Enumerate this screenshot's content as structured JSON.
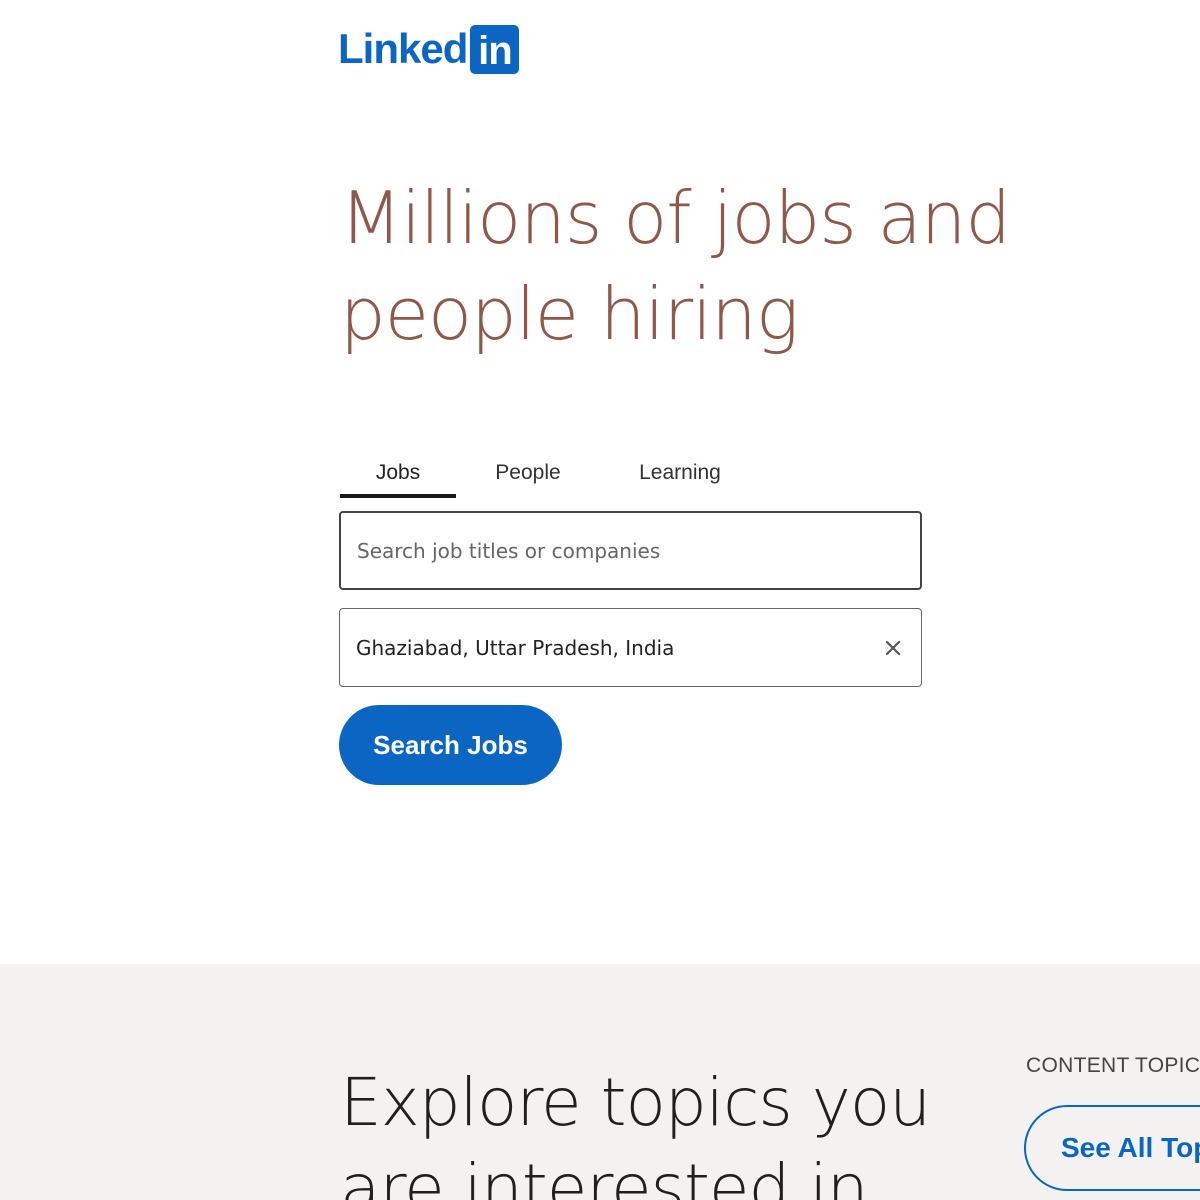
{
  "brand": {
    "logo_text": "Linked",
    "logo_box_text": "in",
    "color": "#0a66c2"
  },
  "hero": {
    "title": "Millions of jobs and people hiring",
    "title_color": "#8f5849"
  },
  "tabs": [
    {
      "label": "Jobs",
      "active": true
    },
    {
      "label": "People",
      "active": false
    },
    {
      "label": "Learning",
      "active": false
    }
  ],
  "search": {
    "keywords_placeholder": "Search job titles or companies",
    "keywords_value": "",
    "location_value": "Ghaziabad, Uttar Pradesh, India",
    "clear_icon": "close-icon",
    "button_label": "Search Jobs"
  },
  "explore": {
    "title": "Explore topics you are interested in",
    "content_topics_label": "CONTENT TOPICS",
    "see_all_label": "See All Topics",
    "background": "#f3f2f0"
  }
}
